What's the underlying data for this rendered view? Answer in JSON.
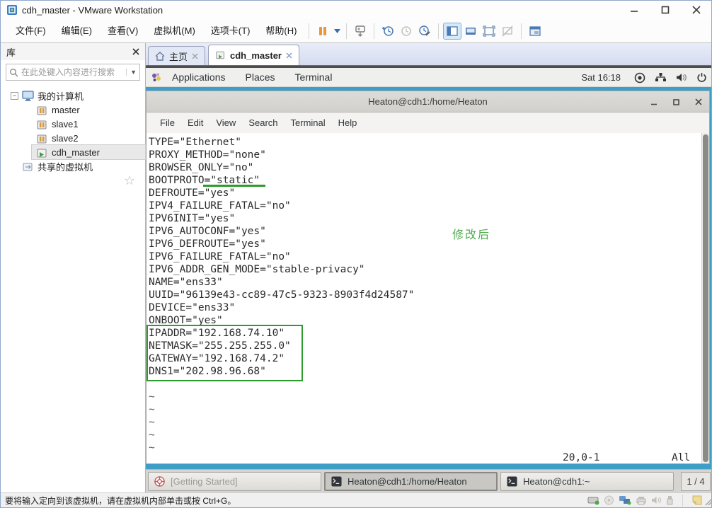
{
  "titlebar": {
    "title": "cdh_master - VMware Workstation"
  },
  "menubar": {
    "items": [
      "文件(F)",
      "编辑(E)",
      "查看(V)",
      "虚拟机(M)",
      "选项卡(T)",
      "帮助(H)"
    ]
  },
  "tabs": {
    "home": "主页",
    "vm": "cdh_master"
  },
  "sidebar": {
    "header": "库",
    "search_placeholder": "在此处键入内容进行搜索",
    "root": "我的计算机",
    "items": [
      "master",
      "slave1",
      "slave2",
      "cdh_master"
    ],
    "shared": "共享的虚拟机",
    "star": "☆"
  },
  "vm": {
    "topbar": {
      "menus": [
        "Applications",
        "Places",
        "Terminal"
      ],
      "clock": "Sat 16:18"
    },
    "terminal": {
      "title": "Heaton@cdh1:/home/Heaton",
      "menus": [
        "File",
        "Edit",
        "View",
        "Search",
        "Terminal",
        "Help"
      ],
      "lines": [
        "TYPE=\"Ethernet\"",
        "PROXY_METHOD=\"none\"",
        "BROWSER_ONLY=\"no\"",
        "BOOTPROTO=\"static\"",
        "DEFROUTE=\"yes\"",
        "IPV4_FAILURE_FATAL=\"no\"",
        "IPV6INIT=\"yes\"",
        "IPV6_AUTOCONF=\"yes\"",
        "IPV6_DEFROUTE=\"yes\"",
        "IPV6_FAILURE_FATAL=\"no\"",
        "IPV6_ADDR_GEN_MODE=\"stable-privacy\"",
        "NAME=\"ens33\"",
        "UUID=\"96139e43-cc89-47c5-9323-8903f4d24587\"",
        "DEVICE=\"ens33\"",
        "ONBOOT=\"yes\"",
        "IPADDR=\"192.168.74.10\"",
        "NETMASK=\"255.255.255.0\"",
        "GATEWAY=\"192.168.74.2\"",
        "DNS1=\"202.98.96.68\""
      ],
      "tilde": "~",
      "cursor_position": "20,0-1",
      "scroll_state": "All",
      "annotation": "修改后"
    },
    "taskbar": {
      "buttons": [
        "[Getting Started]",
        "Heaton@cdh1:/home/Heaton",
        "Heaton@cdh1:~"
      ],
      "workspace": "1 / 4"
    }
  },
  "statusbar": {
    "message": "要将输入定向到该虚拟机，请在虚拟机内部单击或按 Ctrl+G。"
  },
  "colors": {
    "annotation_green": "#2e9b2e",
    "desktop_blue": "#3f9ec6",
    "pause_orange": "#e8973a"
  },
  "icons": {
    "vmware-logo": "blue-cube",
    "search": "magnifier",
    "home-tab": "house",
    "vm-running": "green-play-badge",
    "pause": "orange-pause-bars",
    "snapshot-take": "clock-plus",
    "snapshot-revert": "clock",
    "snapshot-manager": "clock-wrench",
    "library-toggle": "panel-left",
    "console-view": "monitor",
    "fullscreen": "expand-arrows",
    "unity": "monitor-slash",
    "accessibility": "circle-dot",
    "network": "node-tree",
    "volume": "speaker",
    "power": "power-symbol",
    "terminal-app": "dark-terminal",
    "getting-started": "lifebuoy",
    "hdd": "disk",
    "cdrom": "disc",
    "printer": "printer",
    "usb": "usb-plug",
    "message-note": "sticky-note"
  }
}
